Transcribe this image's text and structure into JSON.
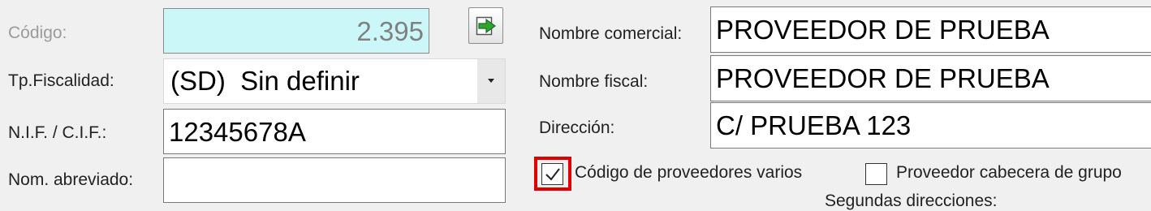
{
  "left": {
    "codigo_label": "Código:",
    "codigo_value": "2.395",
    "tipo_fiscalidad_label": "Tp.Fiscalidad:",
    "tipo_fiscalidad_value": "(SD)  Sin definir",
    "nif_label": "N.I.F. / C.I.F.:",
    "nif_value": "12345678A",
    "nombre_abreviado_label": "Nom. abreviado:",
    "nombre_abreviado_value": ""
  },
  "right": {
    "nombre_comercial_label": "Nombre comercial:",
    "nombre_comercial_value": "PROVEEDOR DE PRUEBA",
    "nombre_fiscal_label": "Nombre  fiscal:",
    "nombre_fiscal_value": "PROVEEDOR DE PRUEBA",
    "direccion_label": "Dirección:",
    "direccion_value": "C/ PRUEBA 123"
  },
  "checkboxes": {
    "codigo_varios_label": "Código de proveedores varios",
    "codigo_varios_checked": true,
    "cabecera_grupo_label": "Proveedor cabecera de grupo",
    "cabecera_grupo_checked": false
  },
  "partial_label": "Segundas direcciones:",
  "icons": {
    "goto_button_icon": "green-arrow-right-icon",
    "dropdown_icon": "chevron-down-icon",
    "check_icon": "checkmark-icon"
  },
  "colors": {
    "code_field_bg": "#ccf7f8",
    "highlight": "#e00000",
    "arrow_green": "#2fa52f"
  }
}
